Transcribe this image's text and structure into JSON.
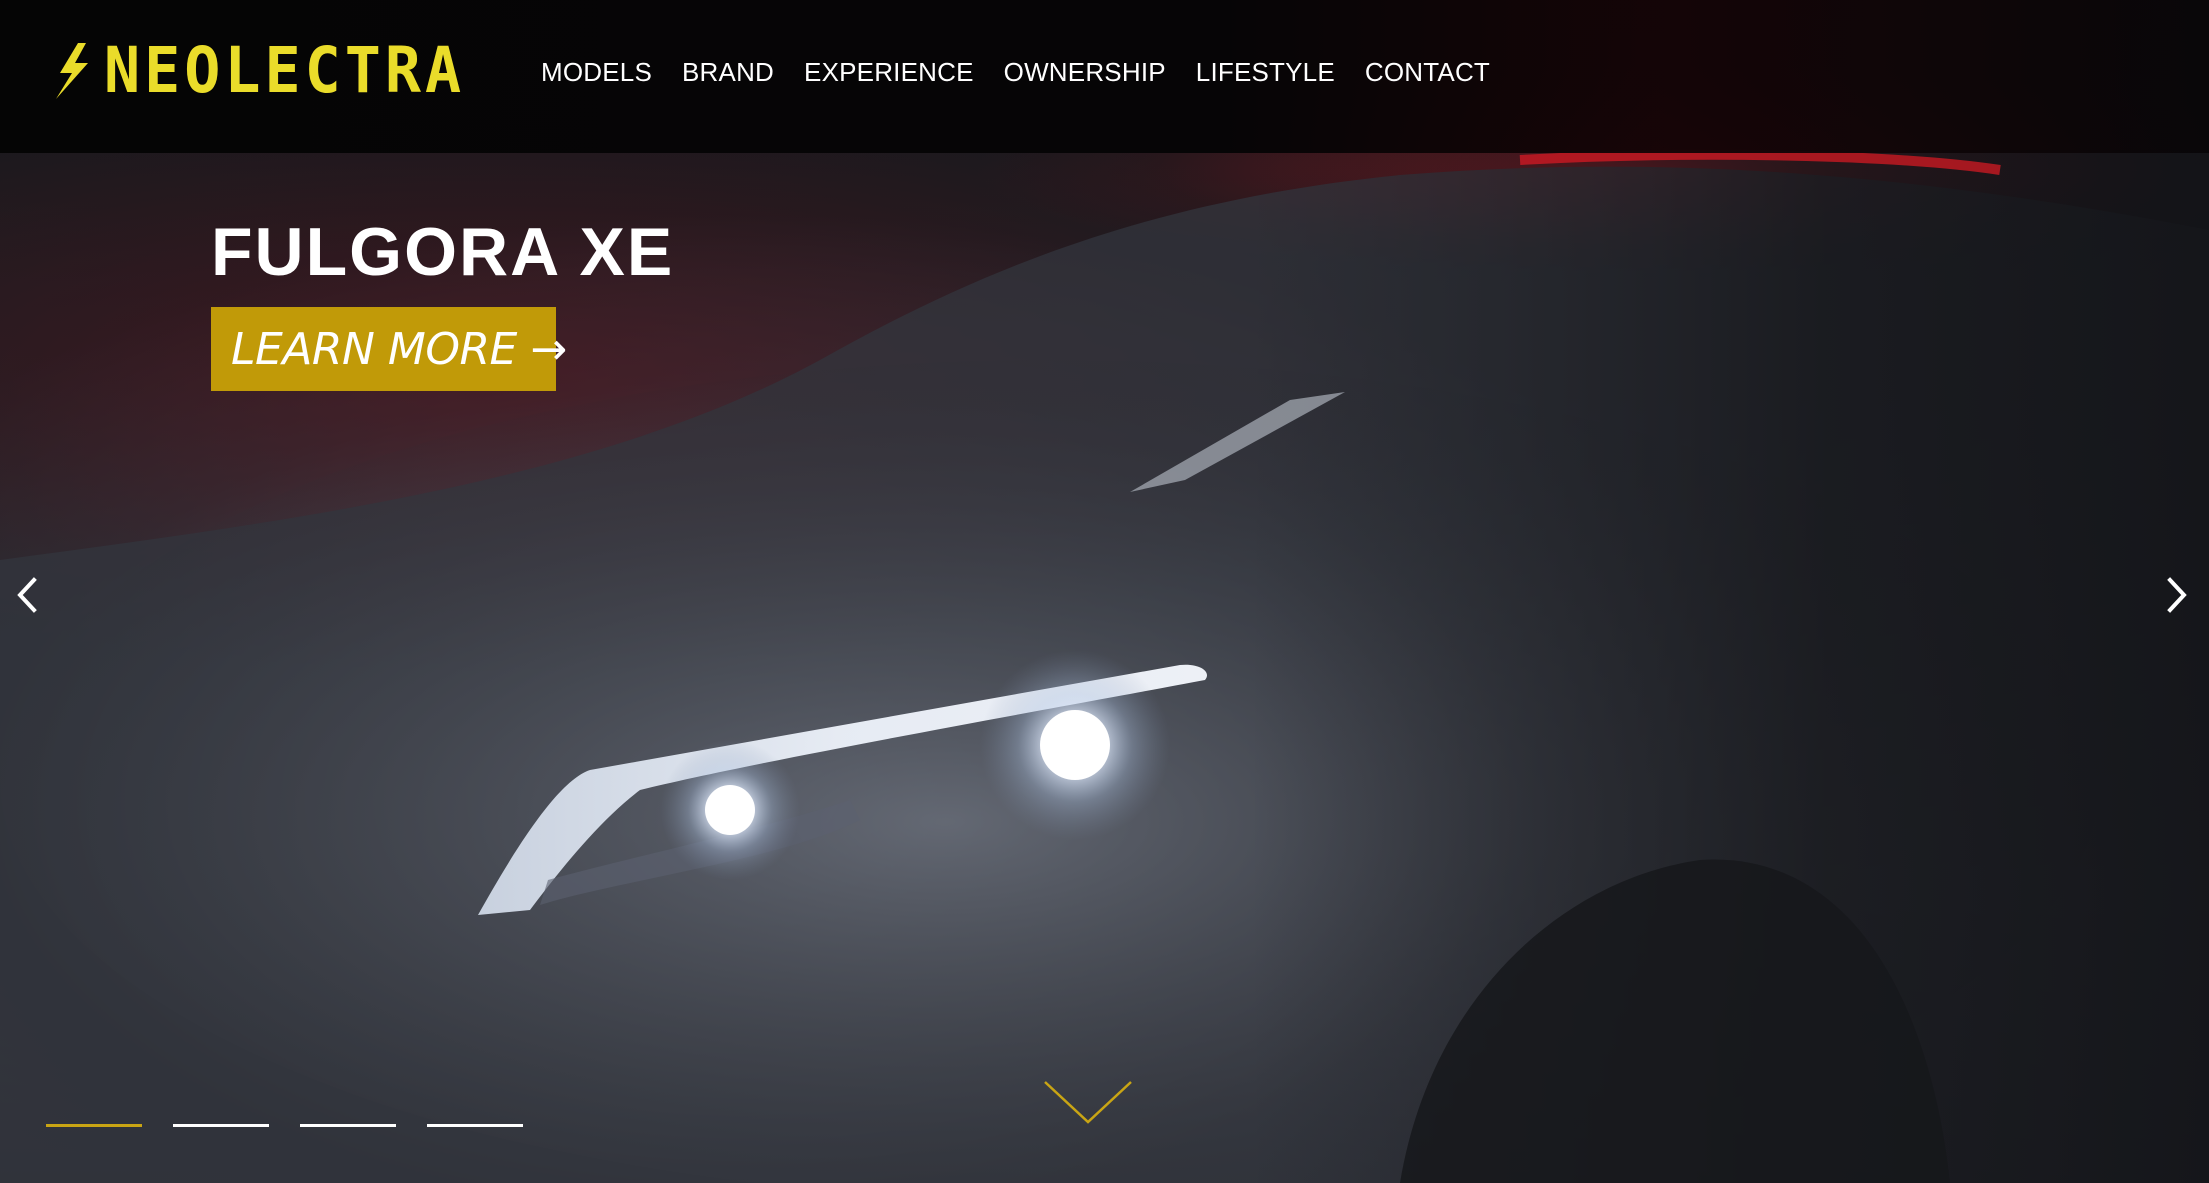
{
  "brand": {
    "name": "NEOLECTRA",
    "logo_icon": "lightning-bolt-icon",
    "color": "#eadc2a"
  },
  "nav": {
    "items": [
      {
        "label": "MODELS"
      },
      {
        "label": "BRAND"
      },
      {
        "label": "EXPERIENCE"
      },
      {
        "label": "OWNERSHIP"
      },
      {
        "label": "LIFESTYLE"
      },
      {
        "label": "CONTACT"
      }
    ]
  },
  "hero": {
    "title": "FULGORA XE",
    "cta_label": "LEARN MORE →",
    "cta_color": "#c19a08"
  },
  "carousel": {
    "prev_icon": "chevron-left-icon",
    "next_icon": "chevron-right-icon",
    "scroll_icon": "chevron-down-icon",
    "slide_count": 4,
    "active_index": 0,
    "active_color": "#c9a514"
  }
}
